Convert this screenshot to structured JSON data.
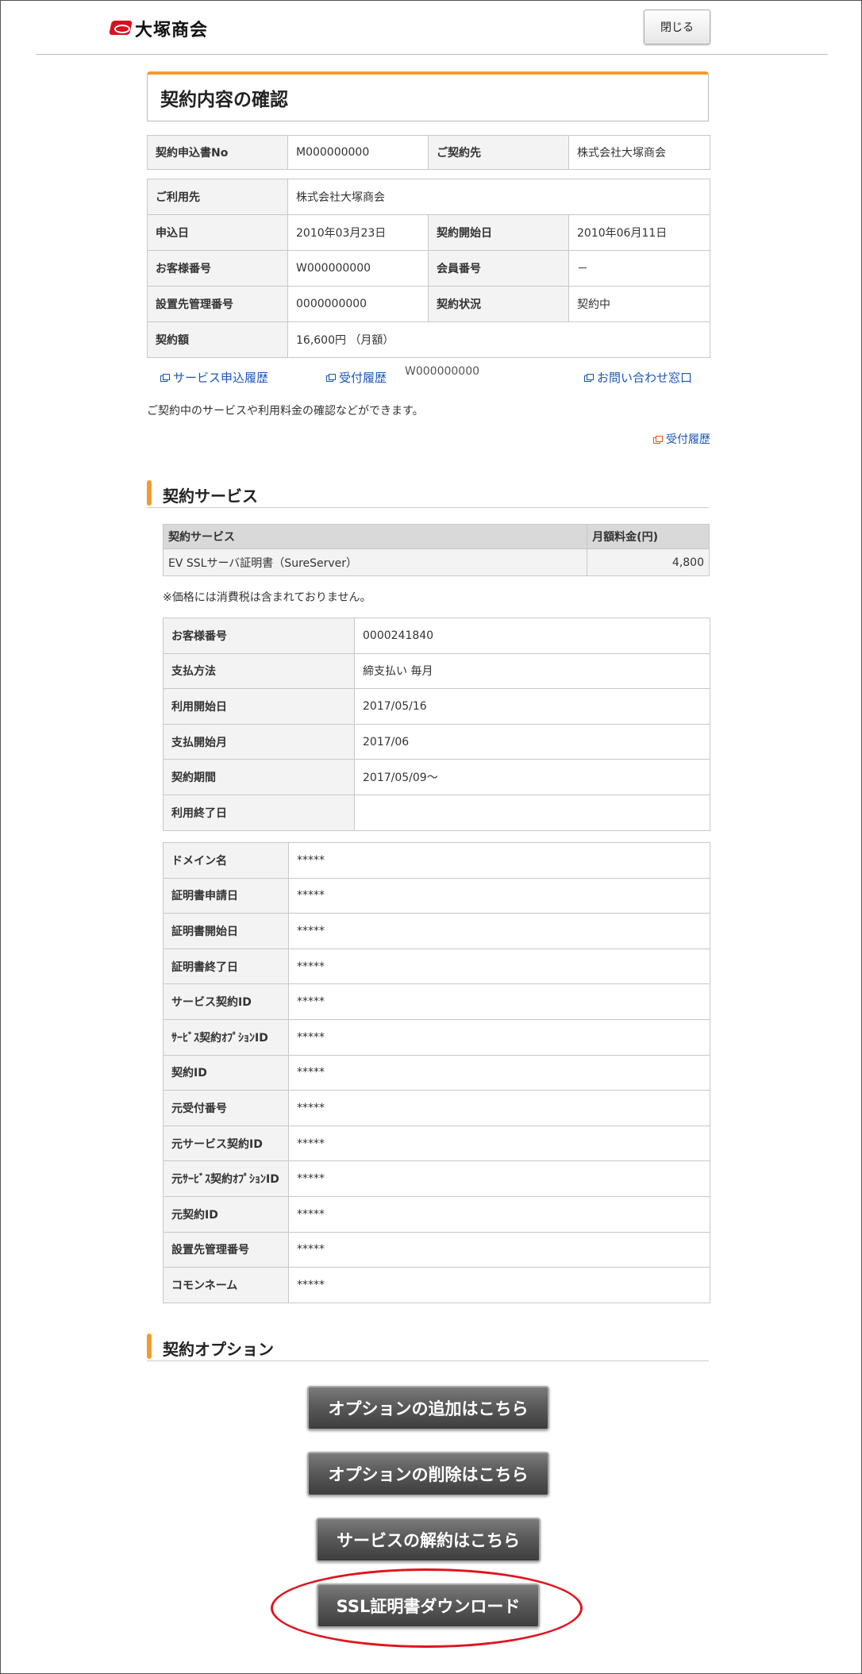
{
  "header": {
    "brand_name": "大塚商会",
    "close_label": "閉じる"
  },
  "page_title": "契約内容の確認",
  "contract_head": {
    "no_label": "契約申込書No",
    "no_value": "M000000000",
    "client_label": "ご契約先",
    "client_value": "株式会社大塚商会"
  },
  "contract_details": {
    "user_label": "ご利用先",
    "user_value": "株式会社大塚商会",
    "apply_date_label": "申込日",
    "apply_date_value": "2010年03月23日",
    "start_date_label": "契約開始日",
    "start_date_value": "2010年06月11日",
    "customer_no_label": "お客様番号",
    "customer_no_value": "W000000000",
    "member_no_label": "会員番号",
    "member_no_value": "－",
    "site_mgmt_label": "設置先管理番号",
    "site_mgmt_value": "0000000000",
    "status_label": "契約状況",
    "status_value": "契約中",
    "amount_label": "契約額",
    "amount_value": "16,600円 （月額）"
  },
  "links": {
    "service_history": "サービス申込履歴",
    "reception_history": "受付履歴",
    "floating_customer_no": "W000000000",
    "inquiry": "お問い合わせ窓口",
    "reception_history_2": "受付履歴"
  },
  "description": "ご契約中のサービスや利用料金の確認などができます。",
  "service_section": {
    "title": "契約サービス",
    "table_header_service": "契約サービス",
    "table_header_fee": "月額料金(円)",
    "service_name": "EV SSLサーバ証明書（SureServer）",
    "service_fee": "4,800",
    "tax_note": "※価格には消費税は含まれておりません。"
  },
  "billing": [
    {
      "label": "お客様番号",
      "value": "0000241840"
    },
    {
      "label": "支払方法",
      "value": "締支払い 毎月"
    },
    {
      "label": "利用開始日",
      "value": "2017/05/16"
    },
    {
      "label": "支払開始月",
      "value": "2017/06"
    },
    {
      "label": "契約期間",
      "value": "2017/05/09～"
    },
    {
      "label": "利用終了日",
      "value": ""
    }
  ],
  "certificate": [
    {
      "label": "ドメイン名",
      "value": "*****"
    },
    {
      "label": "証明書申請日",
      "value": "*****"
    },
    {
      "label": "証明書開始日",
      "value": "*****"
    },
    {
      "label": "証明書終了日",
      "value": "*****"
    },
    {
      "label": "サービス契約ID",
      "value": "*****"
    },
    {
      "label": "ｻｰﾋﾞｽ契約ｵﾌﾟｼｮﾝID",
      "value": "*****"
    },
    {
      "label": "契約ID",
      "value": "*****"
    },
    {
      "label": "元受付番号",
      "value": "*****"
    },
    {
      "label": "元サービス契約ID",
      "value": "*****"
    },
    {
      "label": "元ｻｰﾋﾞｽ契約ｵﾌﾟｼｮﾝID",
      "value": "*****"
    },
    {
      "label": "元契約ID",
      "value": "*****"
    },
    {
      "label": "設置先管理番号",
      "value": "*****"
    },
    {
      "label": "コモンネーム",
      "value": "*****"
    }
  ],
  "option_section": {
    "title": "契約オプション",
    "add_option": "オプションの追加はこちら",
    "delete_option": "オプションの削除はこちら",
    "cancel_service": "サービスの解約はこちら",
    "download_cert": "SSL証明書ダウンロード"
  },
  "colors": {
    "accent_orange": "#f29b2e",
    "link_blue": "#1a55b8",
    "highlight_red": "#e0151f",
    "button_dark": "#555555"
  }
}
